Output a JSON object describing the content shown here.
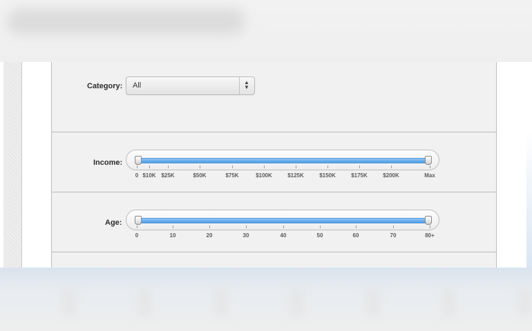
{
  "filters": {
    "category": {
      "label": "Category:",
      "selected": "All"
    },
    "income": {
      "label": "Income:",
      "ticks": [
        "0",
        "$10K",
        "$25K",
        "$50K",
        "$75K",
        "$100K",
        "$125K",
        "$150K",
        "$175K",
        "$200K",
        "Max"
      ],
      "range": {
        "min_tick": "0",
        "max_tick": "Max"
      }
    },
    "age": {
      "label": "Age:",
      "ticks": [
        "0",
        "10",
        "20",
        "30",
        "40",
        "50",
        "60",
        "70",
        "80+"
      ],
      "range": {
        "min_tick": "0",
        "max_tick": "80+"
      }
    }
  },
  "icons": {
    "select_arrows": "up-down-arrows-icon"
  },
  "colors": {
    "slider_fill": "#5aa6ec",
    "panel_bg": "#f1f1f1"
  }
}
